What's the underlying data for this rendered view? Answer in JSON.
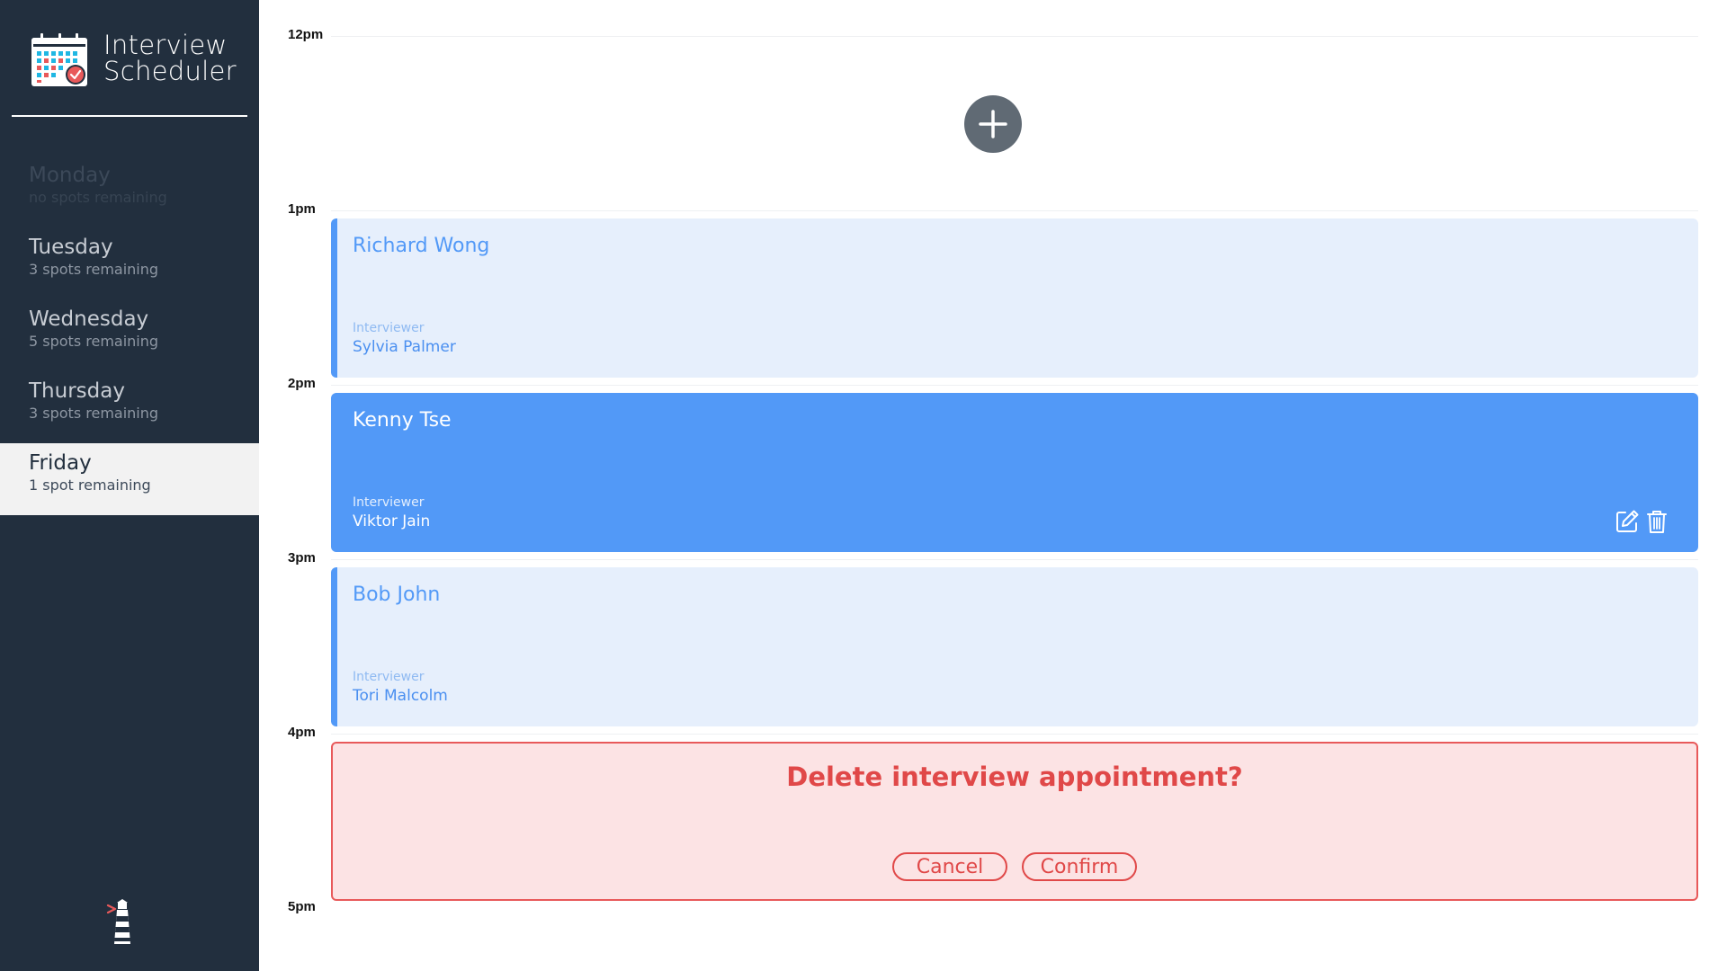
{
  "app": {
    "title_line1": "Interview",
    "title_line2": "Scheduler"
  },
  "days": [
    {
      "name": "Monday",
      "spots": "no spots remaining",
      "state": "full"
    },
    {
      "name": "Tuesday",
      "spots": "3 spots remaining",
      "state": "normal"
    },
    {
      "name": "Wednesday",
      "spots": "5 spots remaining",
      "state": "normal"
    },
    {
      "name": "Thursday",
      "spots": "3 spots remaining",
      "state": "normal"
    },
    {
      "name": "Friday",
      "spots": "1 spot remaining",
      "state": "selected"
    }
  ],
  "schedule": {
    "slots": [
      {
        "time": "12pm",
        "type": "empty"
      },
      {
        "time": "1pm",
        "type": "appointment",
        "student": "Richard Wong",
        "interviewer_label": "Interviewer",
        "interviewer": "Sylvia Palmer"
      },
      {
        "time": "2pm",
        "type": "appointment",
        "state": "hover",
        "student": "Kenny Tse",
        "interviewer_label": "Interviewer",
        "interviewer": "Viktor Jain"
      },
      {
        "time": "3pm",
        "type": "appointment",
        "student": "Bob John",
        "interviewer_label": "Interviewer",
        "interviewer": "Tori Malcolm"
      },
      {
        "time": "4pm",
        "type": "confirm",
        "message": "Delete interview appointment?",
        "cancel_label": "Cancel",
        "confirm_label": "Confirm"
      },
      {
        "time": "5pm",
        "type": "end"
      }
    ]
  },
  "icons": {
    "brand": "calendar-check-icon",
    "add": "plus-icon",
    "edit": "edit-icon",
    "delete": "trash-icon",
    "footer": "lighthouse-logo-icon"
  },
  "colors": {
    "sidebar": "#222f3e",
    "selected_day": "#f2f2f2",
    "accent_blue": "#5299f7",
    "card_bg": "#e6effc",
    "danger": "#e04848",
    "danger_bg": "#fce3e4",
    "add_button": "#606a74"
  }
}
